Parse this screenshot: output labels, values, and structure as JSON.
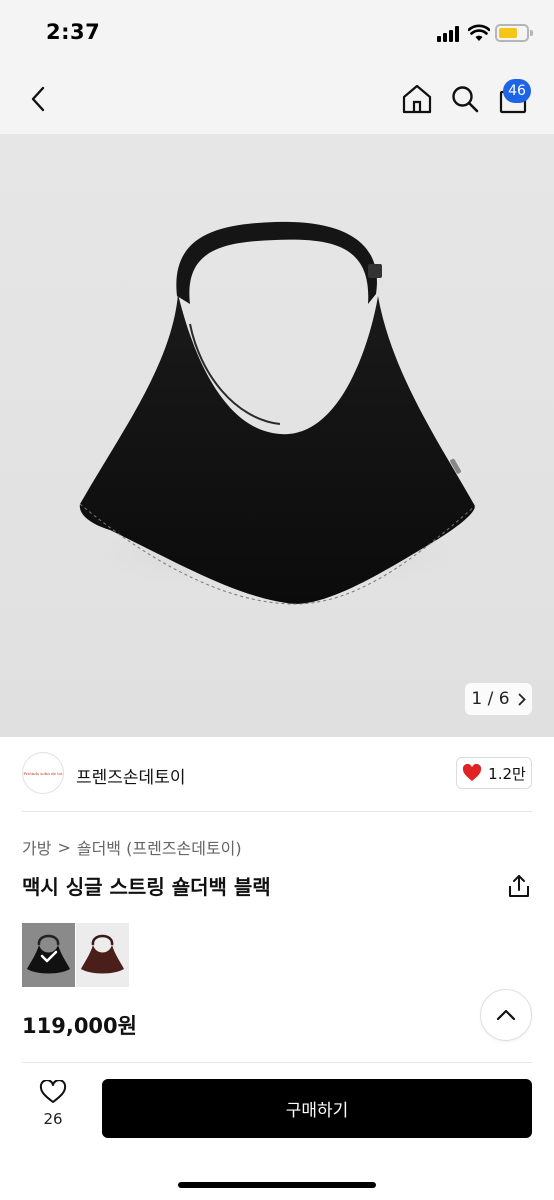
{
  "status_bar": {
    "time": "2:37",
    "battery_color": "#f5c518"
  },
  "nav": {
    "back_icon": "chevron-left-icon",
    "home_icon": "home-icon",
    "search_icon": "search-icon",
    "cart_icon": "bag-icon",
    "cart_badge": "46",
    "badge_color": "#1e64e6"
  },
  "gallery": {
    "pager": "1 / 6",
    "pager_next_icon": "chevron-right-icon"
  },
  "shop": {
    "logo_text": "Friends sohn de toi",
    "name": "프렌즈손데토이",
    "follow_count": "1.2만",
    "follow_icon": "heart-icon",
    "heart_color": "#e02424"
  },
  "product": {
    "breadcrumb": [
      "가방",
      "숄더백 (프렌즈손데토이)"
    ],
    "breadcrumb_separator": ">",
    "title": "맥시 싱글 스트링 숄더백 블랙",
    "share_icon": "share-icon",
    "variants": [
      {
        "name": "black",
        "selected": true
      },
      {
        "name": "brown",
        "selected": false
      }
    ],
    "price": "119,000원"
  },
  "bottom_bar": {
    "like_icon": "heart-outline-icon",
    "like_count": "26",
    "buy_label": "구매하기"
  }
}
